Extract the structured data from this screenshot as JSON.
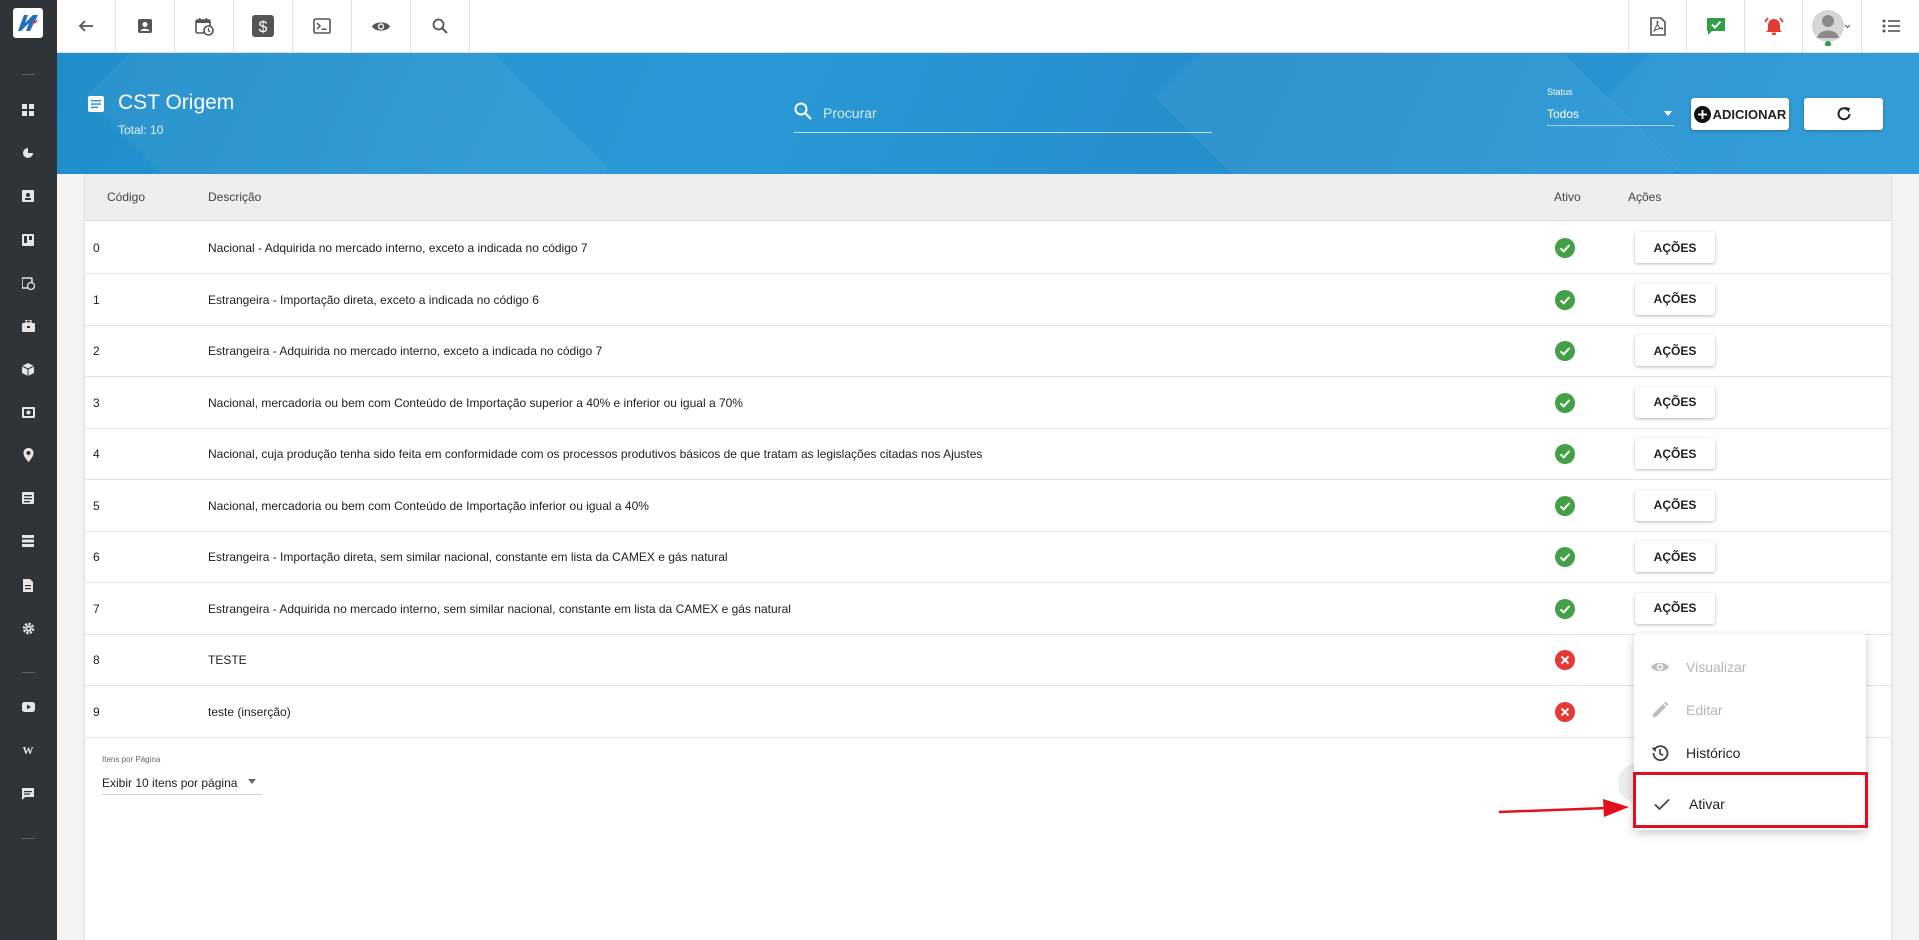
{
  "page": {
    "title": "CST Origem",
    "total": "Total: 10"
  },
  "search": {
    "placeholder": "Procurar"
  },
  "filters": {
    "status_label": "Status",
    "status_value": "Todos"
  },
  "buttons": {
    "add_label": "ADICIONAR"
  },
  "table": {
    "headers": [
      "Código",
      "Descrição",
      "Ativo",
      "Ações"
    ],
    "action_label": "AÇÕES",
    "rows": [
      {
        "code": "0",
        "desc": "Nacional - Adquirida no mercado interno, exceto a indicada no código 7",
        "active": true
      },
      {
        "code": "1",
        "desc": "Estrangeira - Importação direta, exceto a indicada no código 6",
        "active": true
      },
      {
        "code": "2",
        "desc": "Estrangeira - Adquirida no mercado interno, exceto a indicada no código 7",
        "active": true
      },
      {
        "code": "3",
        "desc": "Nacional, mercadoria ou bem com Conteúdo de Importação superior a 40% e inferior ou igual a 70%",
        "active": true
      },
      {
        "code": "4",
        "desc": "Nacional, cuja produção tenha sido feita em conformidade com os processos produtivos básicos de que tratam as legislações citadas nos Ajustes",
        "active": true
      },
      {
        "code": "5",
        "desc": "Nacional, mercadoria ou bem com Conteúdo de Importação inferior ou igual a 40%",
        "active": true
      },
      {
        "code": "6",
        "desc": "Estrangeira - Importação direta, sem similar nacional, constante em lista da CAMEX e gás natural",
        "active": true
      },
      {
        "code": "7",
        "desc": "Estrangeira - Adquirida no mercado interno, sem similar nacional, constante em lista da CAMEX e gás natural",
        "active": true
      },
      {
        "code": "8",
        "desc": "TESTE",
        "active": false
      },
      {
        "code": "9",
        "desc": "teste (inserção)",
        "active": false
      }
    ]
  },
  "pagination": {
    "label": "Itens por Página",
    "value": "Exibir 10 itens por página"
  },
  "context_menu": {
    "items": [
      {
        "label": "Visualizar",
        "icon": "eye-icon",
        "disabled": true
      },
      {
        "label": "Editar",
        "icon": "pencil-icon",
        "disabled": true
      },
      {
        "label": "Histórico",
        "icon": "history-icon",
        "disabled": false
      },
      {
        "label": "Ativar",
        "icon": "check-icon",
        "disabled": false
      }
    ]
  },
  "colors": {
    "header_blue": "#2a9ad6",
    "sidebar": "#2f3439",
    "active_green": "#43a047",
    "inactive_red": "#e53935",
    "highlight_red": "#e3101b"
  },
  "icons": {
    "sidebar": [
      "dashboard-icon",
      "pie-chart-icon",
      "contact-icon",
      "board-icon",
      "calendar-clock-icon",
      "briefcase-icon",
      "cube-icon",
      "money-icon",
      "location-icon",
      "list-icon",
      "server-icon",
      "document-icon",
      "gear-icon",
      "youtube-icon",
      "wiki-icon",
      "chat-icon"
    ],
    "toolbar_left": [
      "back-arrow-icon",
      "contact-card-icon",
      "calendar-clock-icon",
      "dollar-icon",
      "terminal-icon",
      "eye-icon",
      "search-icon"
    ],
    "toolbar_right": [
      "pdf-icon",
      "task-check-icon",
      "alarm-icon",
      "avatar",
      "menu-list-icon"
    ]
  }
}
